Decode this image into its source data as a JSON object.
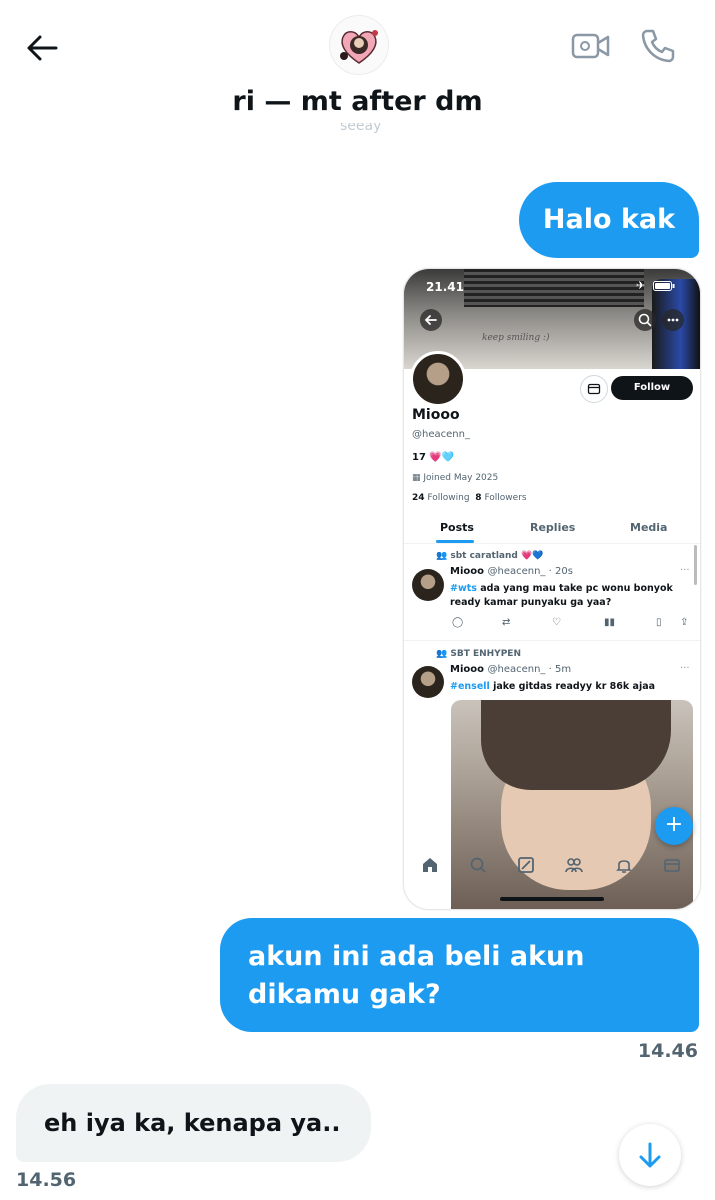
{
  "header": {
    "title": "ri — mt after dm",
    "ghost_text": "seeay"
  },
  "messages": {
    "m1": "Halo kak",
    "m2": "akun ini ada beli akun dikamu gak?",
    "m2_time": "14.46",
    "m3": "eh iya ka, kenapa ya..",
    "m3_time": "14.56"
  },
  "shared_screenshot": {
    "status_time": "21.41",
    "wall_text": "keep smiling :)",
    "profile": {
      "name": "Miooo",
      "handle": "@heacenn_",
      "bio": "17 💗🩵",
      "joined": "Joined May 2025",
      "following_count": "24",
      "following_label": "Following",
      "followers_count": "8",
      "followers_label": "Followers",
      "follow_label": "Follow"
    },
    "tabs": [
      "Posts",
      "Replies",
      "Media"
    ],
    "posts": [
      {
        "community": "sbt caratland 💗💙",
        "author": "Miooo",
        "meta": "@heacenn_ · 20s",
        "hashtag": "#wts",
        "text": " ada yang mau take pc wonu bonyok ready kamar punyaku ga yaa?"
      },
      {
        "community": "SBT ENHYPEN",
        "author": "Miooo",
        "meta": "@heacenn_ · 5m",
        "hashtag": "#ensell",
        "text": " jake gitdas readyy kr 86k ajaa"
      }
    ],
    "fab_label": "+"
  },
  "colors": {
    "accent": "#1d9bf0",
    "incoming_bubble": "#eff3f4",
    "text": "#0f1419",
    "muted": "#536471"
  }
}
